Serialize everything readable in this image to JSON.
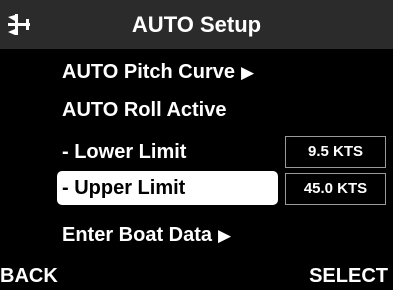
{
  "header": {
    "title": "AUTO Setup",
    "icon": "boat-icon"
  },
  "menu": {
    "items": [
      {
        "label": "AUTO Pitch Curve",
        "arrow": "▶"
      },
      {
        "label": "AUTO Roll Active"
      },
      {
        "label": "- Lower Limit",
        "value": "9.5 KTS"
      },
      {
        "label": "- Upper Limit",
        "value": "45.0 KTS",
        "selected": true
      },
      {
        "label": "Enter Boat Data",
        "arrow": "▶"
      }
    ]
  },
  "softkeys": {
    "back": "BACK",
    "select": "SELECT"
  },
  "colors": {
    "background": "#000000",
    "header": "#2b2b2b",
    "selected_bg": "#ffffff",
    "text": "#ffffff"
  }
}
